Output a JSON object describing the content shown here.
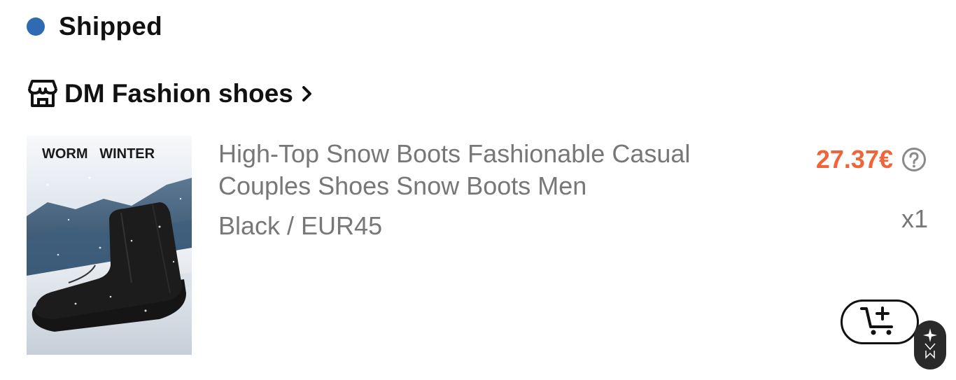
{
  "order": {
    "status_label": "Shipped",
    "status_color": "#2e6bb3"
  },
  "store": {
    "name": "DM Fashion shoes",
    "icon": "store-icon",
    "chevron_icon": "chevron-right-icon"
  },
  "product": {
    "image_overlay_text": "WORM   WINTER",
    "title": "High-Top Snow Boots Fashionable Casual Couples Shoes Snow Boots Men",
    "variant": "Black / EUR45",
    "price": "27.37€",
    "price_color": "#f0643a",
    "quantity": "x1",
    "help_icon": "question-circle-icon"
  },
  "actions": {
    "add_to_cart_icon": "cart-plus-icon",
    "floating_badge_icon": "assistant-logo-icon"
  }
}
